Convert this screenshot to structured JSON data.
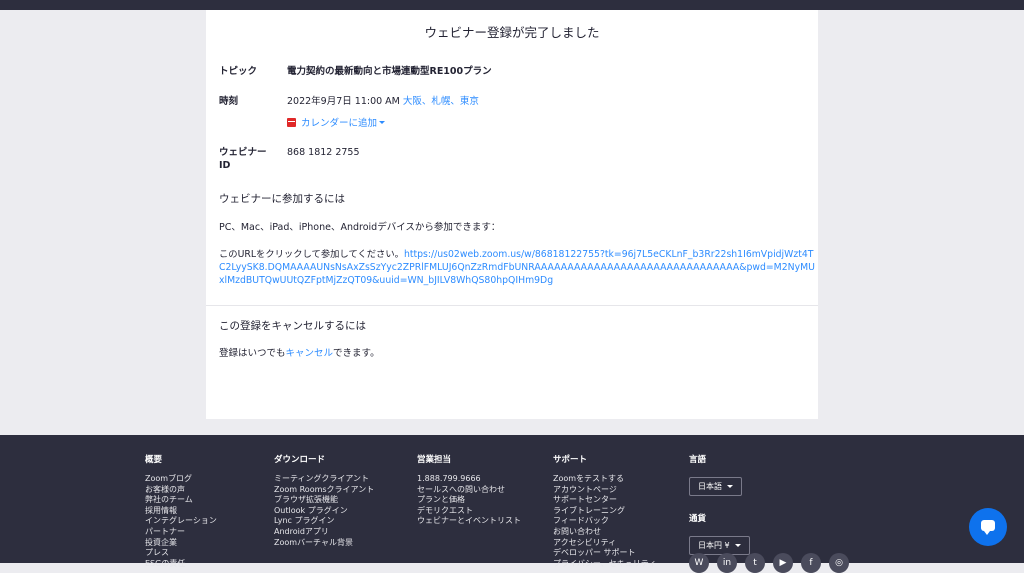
{
  "page": {
    "title": "ウェビナー登録が完了しました"
  },
  "details": {
    "topic_label": "トピック",
    "topic_value": "電力契約の最新動向と市場連動型RE100プラン",
    "time_label": "時刻",
    "time_value": "2022年9月7日 11:00 AM",
    "timezone": "大阪、札幌、東京",
    "calendar_label": "カレンダーに追加",
    "webinar_id_label_1": "ウェビナー",
    "webinar_id_label_2": "ID",
    "webinar_id_value": "868 1812 2755"
  },
  "join": {
    "heading": "ウェビナーに参加するには",
    "devices_text": "PC、Mac、iPad、iPhone、Androidデバイスから参加できます：",
    "url_prefix": "このURLをクリックして参加してください。",
    "url": "https://us02web.zoom.us/w/86818122755?tk=96j7L5eCKLnF_b3Rr22sh1I6mVpidjWzt4TC2LyySK8.DQMAAAAUNsNsAxZsSzYyc2ZPRlFMLUJ6QnZzRmdFbUNRAAAAAAAAAAAAAAAAAAAAAAAAAAAAAAA&pwd=M2NyMUxlMzdBUTQwUUtQZFptMjZzQT09&uuid=WN_bJILV8WhQS80hpQIHm9Dg"
  },
  "cancel": {
    "heading": "この登録をキャンセルするには",
    "text_before": "登録はいつでも",
    "link": "キャンセル",
    "text_after": "できます。"
  },
  "footer": {
    "col1": {
      "heading": "概要",
      "items": [
        "Zoomブログ",
        "お客様の声",
        "弊社のチーム",
        "採用情報",
        "インテグレーション",
        "パートナー",
        "投資企業",
        "プレス",
        "ESGの責任"
      ]
    },
    "col2": {
      "heading": "ダウンロード",
      "items": [
        "ミーティングクライアント",
        "Zoom Roomsクライアント",
        "ブラウザ拡張機能",
        "Outlook プラグイン",
        "Lync プラグイン",
        "Androidアプリ",
        "Zoomバーチャル背景"
      ]
    },
    "col3": {
      "heading": "営業担当",
      "items": [
        "1.888.799.9666",
        "セールスへの問い合わせ",
        "プランと価格",
        "デモリクエスト",
        "ウェビナーとイベントリスト"
      ]
    },
    "col4": {
      "heading": "サポート",
      "items": [
        "Zoomをテストする",
        "アカウントページ",
        "サポートセンター",
        "ライブトレーニング",
        "フィードバック",
        "お問い合わせ",
        "アクセシビリティ",
        "デベロッパー サポート",
        "プライバシー、セキュリティ"
      ]
    },
    "language": {
      "heading": "言語",
      "value": "日本語"
    },
    "currency": {
      "heading": "通貨",
      "value": "日本円 ¥"
    }
  },
  "colors": {
    "link": "#2d8cff",
    "footer_bg": "#2d2e3e",
    "chat_button": "#0e72ed"
  }
}
